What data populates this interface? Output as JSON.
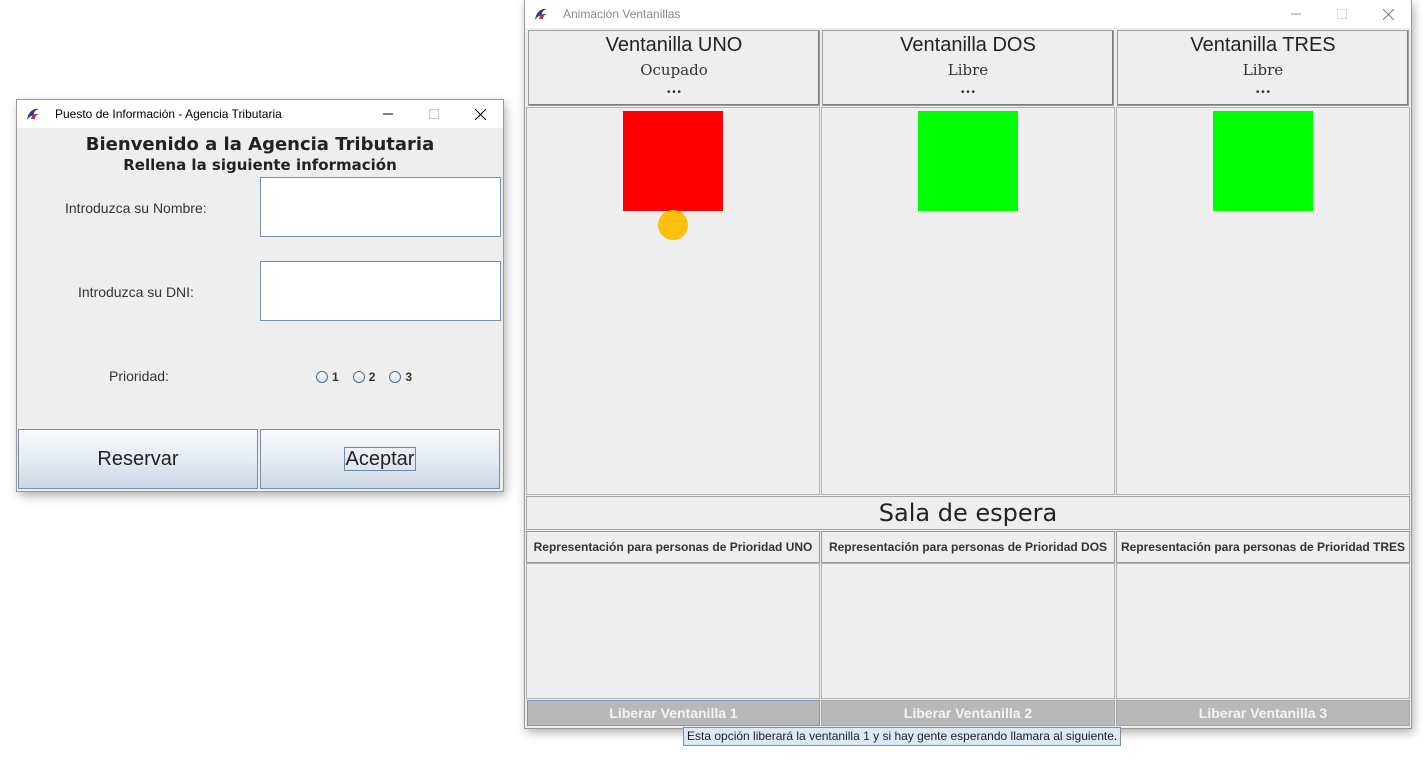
{
  "info_window": {
    "title": "Puesto de Información - Agencia Tributaria",
    "welcome": "Bienvenido a la Agencia Tributaria",
    "subtitle": "Rellena la siguiente información",
    "name_label": "Introduzca su Nombre:",
    "name_value": "",
    "dni_label": "Introduzca su DNI:",
    "dni_value": "",
    "priority_label": "Prioridad:",
    "priority_options": [
      "1",
      "2",
      "3"
    ],
    "priority_selected": null,
    "reserve_button": "Reservar",
    "accept_button": "Aceptar"
  },
  "anim_window": {
    "title": "Animación Ventanillas",
    "ventanillas": [
      {
        "name": "Ventanilla UNO",
        "state": "Ocupado",
        "dots": "...",
        "color": "#ff0000",
        "has_person": true
      },
      {
        "name": "Ventanilla DOS",
        "state": "Libre",
        "dots": "...",
        "color": "#00ff00",
        "has_person": false
      },
      {
        "name": "Ventanilla TRES",
        "state": "Libre",
        "dots": "...",
        "color": "#00ff00",
        "has_person": false
      }
    ],
    "person_color": "#fcc00c",
    "waiting_room_title": "Sala de espera",
    "priority_headers": [
      "Representación para personas de Prioridad UNO",
      "Representación para personas de Prioridad DOS",
      "Representación para personas de Prioridad TRES"
    ],
    "release_buttons": [
      "Liberar Ventanilla 1",
      "Liberar Ventanilla 2",
      "Liberar Ventanilla 3"
    ],
    "tooltip": "Esta opción liberará la ventanilla 1 y si hay gente esperando llamara al siguiente."
  },
  "icons": {
    "app": "java-app-icon",
    "minimize": "minimize-icon",
    "maximize": "maximize-icon",
    "close": "close-icon"
  }
}
